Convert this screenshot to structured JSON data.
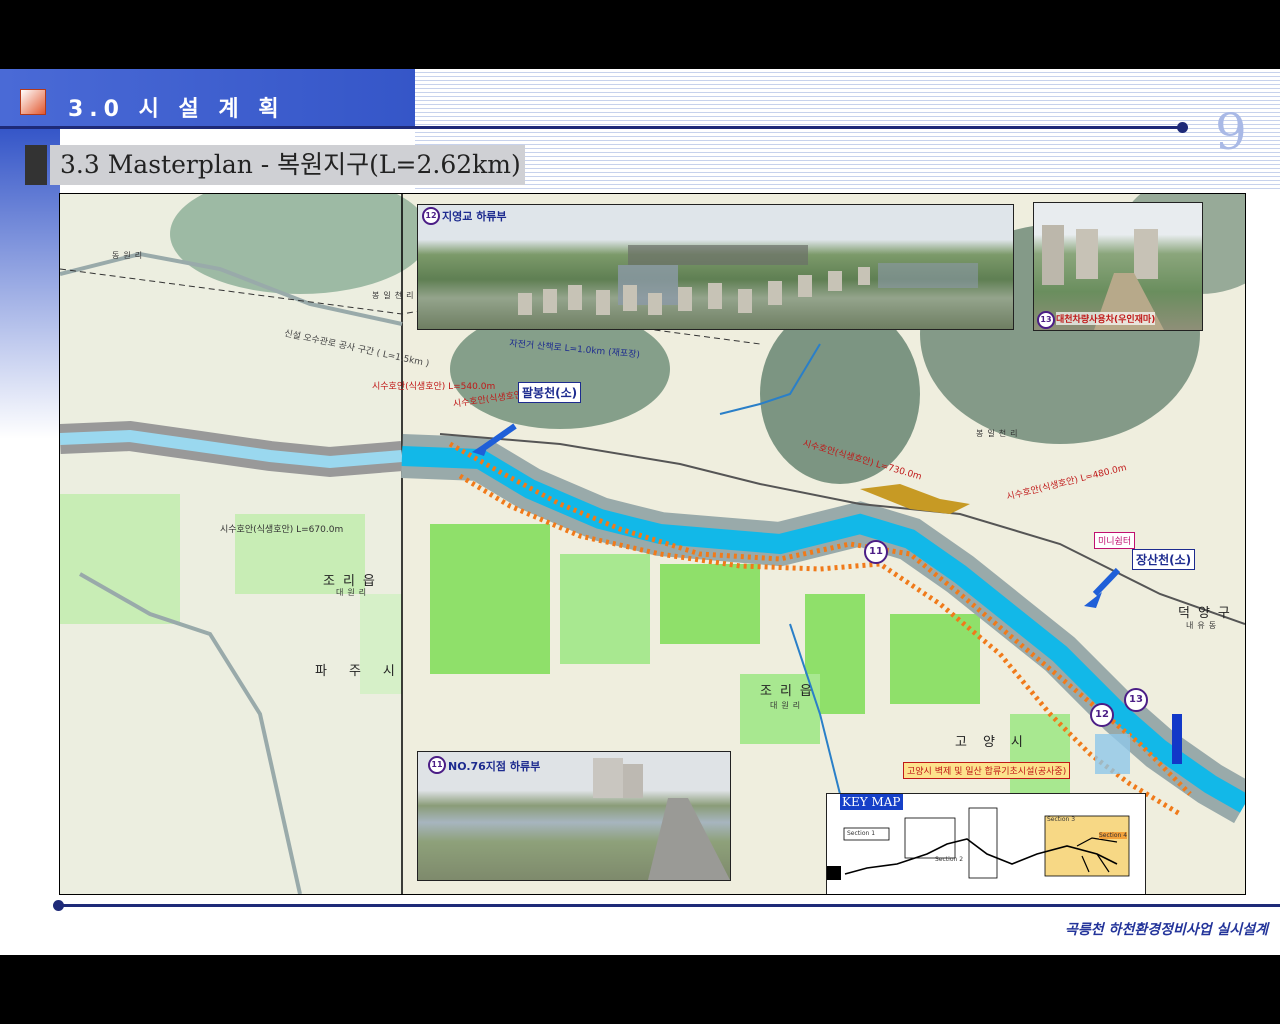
{
  "header": {
    "section_title": "3.0 시 설 계 획",
    "page_number": "9"
  },
  "subtitle": "3.3 Masterplan - 복원지구(L=2.62km)",
  "photos": {
    "top_panorama_caption": "지영교 하류부",
    "top_panorama_marker": "12",
    "top_right_caption": "대천차량사용차(우인재마)",
    "top_right_marker": "13",
    "bottom_left_caption": "NO.76지점 하류부",
    "bottom_left_marker": "11"
  },
  "map": {
    "labels": {
      "jori_eup_left": "조리읍",
      "daewon_ri_left": "대원리",
      "paju_si": "파주시",
      "jori_eup_center": "조리읍",
      "daewon_ri_center": "대원리",
      "goyang_si": "고양시",
      "deokyang_gu": "덕양구",
      "naeyu_dong": "내유동",
      "bongil_cheon_top": "봉일천리",
      "bongil_cheon_right": "봉일천리",
      "dongwon_ri": "동원리"
    },
    "callouts": {
      "paldong_cheon": "팔봉천(소)",
      "jangsan_cheon": "장산천(소)",
      "mini_garden": "미니쉼터"
    },
    "markers": [
      "11",
      "12",
      "13"
    ],
    "notes": {
      "note_sewer": "신설 오수관로 공사 구간 ( L=1.5km )",
      "note_revetment_left": "시수호안(식생호안) L=670.0m",
      "note_revetment_top": "시수호안(식생호안) L=540.0m",
      "note_revetment_red": "시수호안(식생호안) L=24.0m",
      "note_revetment_right": "시수호안(식생호안) L=480.0m",
      "note_revetment_center": "시수호안(식생호안) L=730.0m",
      "note_road": "자전거 산책로 L=1.0km (재포장)",
      "note_facility": "고양시 벽제 및 일산 합류기초시설(공사중)"
    },
    "keymap_label": "KEY MAP",
    "keymap_boxes": [
      "Section 1",
      "Section 2",
      "Section 3",
      "Section 4"
    ]
  },
  "footer": "곡릉천 하천환경정비사업 실시설계",
  "colors": {
    "header_blue": "#3556c8",
    "rule_navy": "#1e2a78",
    "river_blue": "#12b8e8",
    "route_orange": "#f07a1a",
    "field_green": "#8fe06a"
  }
}
